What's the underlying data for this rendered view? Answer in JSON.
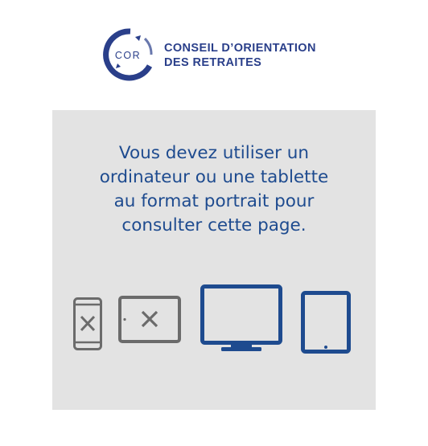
{
  "logo": {
    "monogram": "COR",
    "name_line1": "CONSEIL D’ORIENTATION",
    "name_line2": "DES RETRAITES"
  },
  "message": {
    "lines": [
      "Vous devez utiliser un",
      "ordinateur ou une tablette",
      "au format portrait pour",
      "consulter cette page."
    ]
  },
  "devices": [
    {
      "icon": "smartphone-icon",
      "status": "not-supported"
    },
    {
      "icon": "tablet-landscape-icon",
      "status": "not-supported"
    },
    {
      "icon": "desktop-monitor-icon",
      "status": "supported"
    },
    {
      "icon": "tablet-portrait-icon",
      "status": "supported"
    }
  ],
  "colors": {
    "brand": "#2a3f8a",
    "accent": "#1e4b8f",
    "unsupported": "#6b6b6b",
    "panel": "#e3e3e3"
  }
}
